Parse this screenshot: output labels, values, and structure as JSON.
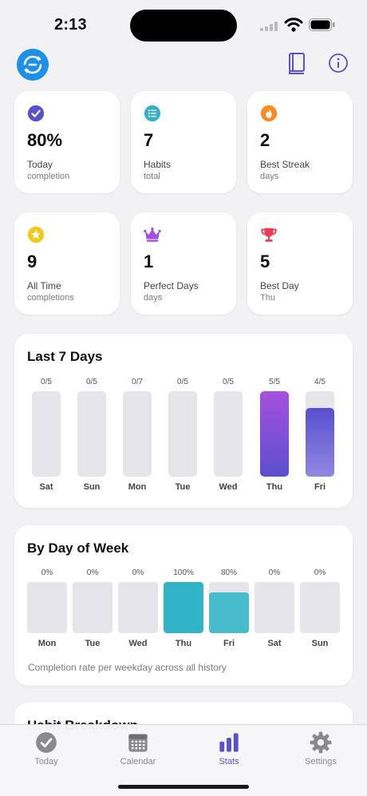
{
  "status_bar": {
    "time": "2:13"
  },
  "stats": [
    {
      "icon": "check-circle-icon",
      "color": "#5a4fcf",
      "value": "80%",
      "label": "Today",
      "sub": "completion"
    },
    {
      "icon": "list-icon",
      "color": "#33b0c9",
      "value": "7",
      "label": "Habits",
      "sub": "total"
    },
    {
      "icon": "flame-icon",
      "color": "#ff8a1f",
      "value": "2",
      "label": "Best Streak",
      "sub": "days"
    },
    {
      "icon": "star-icon",
      "color": "#f5c71a",
      "value": "9",
      "label": "All Time",
      "sub": "completions"
    },
    {
      "icon": "crown-icon",
      "color": "#a04fe0",
      "value": "1",
      "label": "Perfect Days",
      "sub": "days"
    },
    {
      "icon": "trophy-icon",
      "color": "#f03a5a",
      "value": "5",
      "label": "Best Day",
      "sub": "Thu"
    }
  ],
  "last7": {
    "title": "Last 7 Days",
    "days": [
      {
        "day": "Sat",
        "label": "0/5",
        "done": 0,
        "total": 5
      },
      {
        "day": "Sun",
        "label": "0/5",
        "done": 0,
        "total": 5
      },
      {
        "day": "Mon",
        "label": "0/7",
        "done": 0,
        "total": 7
      },
      {
        "day": "Tue",
        "label": "0/5",
        "done": 0,
        "total": 5
      },
      {
        "day": "Wed",
        "label": "0/5",
        "done": 0,
        "total": 5
      },
      {
        "day": "Thu",
        "label": "5/5",
        "done": 5,
        "total": 5
      },
      {
        "day": "Fri",
        "label": "4/5",
        "done": 4,
        "total": 5
      }
    ]
  },
  "by_weekday": {
    "title": "By Day of Week",
    "days": [
      {
        "day": "Mon",
        "label": "0%",
        "pct": 0
      },
      {
        "day": "Tue",
        "label": "0%",
        "pct": 0
      },
      {
        "day": "Wed",
        "label": "0%",
        "pct": 0
      },
      {
        "day": "Thu",
        "label": "100%",
        "pct": 100
      },
      {
        "day": "Fri",
        "label": "80%",
        "pct": 80
      },
      {
        "day": "Sat",
        "label": "0%",
        "pct": 0
      },
      {
        "day": "Sun",
        "label": "0%",
        "pct": 0
      }
    ],
    "caption": "Completion rate per weekday across all history"
  },
  "breakdown": {
    "title": "Habit Breakdown"
  },
  "tabs": [
    {
      "label": "Today",
      "icon": "checkmark-circle-icon"
    },
    {
      "label": "Calendar",
      "icon": "calendar-icon"
    },
    {
      "label": "Stats",
      "icon": "bar-chart-icon",
      "active": true
    },
    {
      "label": "Settings",
      "icon": "gear-icon"
    }
  ],
  "colors": {
    "accent": "#5a4fcf",
    "teal": "#32b4c8",
    "track": "#e5e5ea"
  }
}
